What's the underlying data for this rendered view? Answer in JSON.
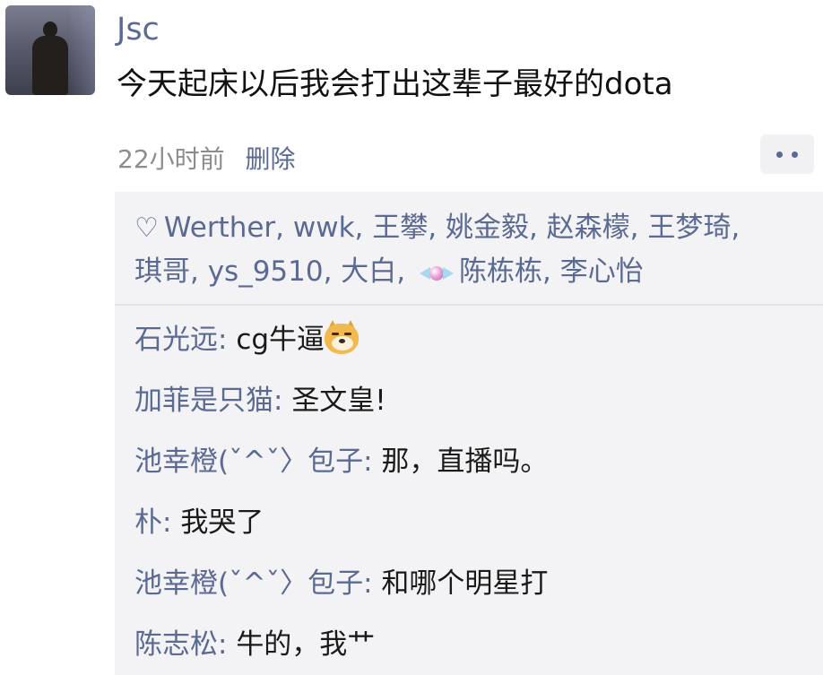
{
  "post": {
    "username": "Jsc",
    "text": "今天起床以后我会打出这辈子最好的dota",
    "time": "22小时前",
    "delete_label": "删除"
  },
  "likes": {
    "icon": "heart-outline-icon",
    "text_before_icon": "Werther, wwk, 王攀, 姚金毅, 赵森檬, 王梦琦, 琪哥, ys_9510, 大白, ",
    "inline_icon": "candy-icon",
    "text_after_icon": "陈栋栋, 李心怡"
  },
  "comments": [
    {
      "author": "石光远",
      "sep": ": ",
      "content": "cg牛逼",
      "emoji": "doge-icon"
    },
    {
      "author": "加菲是只猫",
      "sep": ": ",
      "content": "圣文皇!"
    },
    {
      "author": "池幸橙(ˇ^ˇ〉包子",
      "sep": ": ",
      "content": "那，直播吗。"
    },
    {
      "author": "朴",
      "sep": ": ",
      "content": "我哭了"
    },
    {
      "author": "池幸橙(ˇ^ˇ〉包子",
      "sep": ": ",
      "content": "和哪个明星打"
    },
    {
      "author": "陈志松",
      "sep": ": ",
      "content": "牛的，我艹"
    }
  ],
  "colors": {
    "link": "#5b6a93",
    "meta": "#8c8c8c",
    "text": "#111111",
    "panel_bg": "#f3f3f5"
  }
}
